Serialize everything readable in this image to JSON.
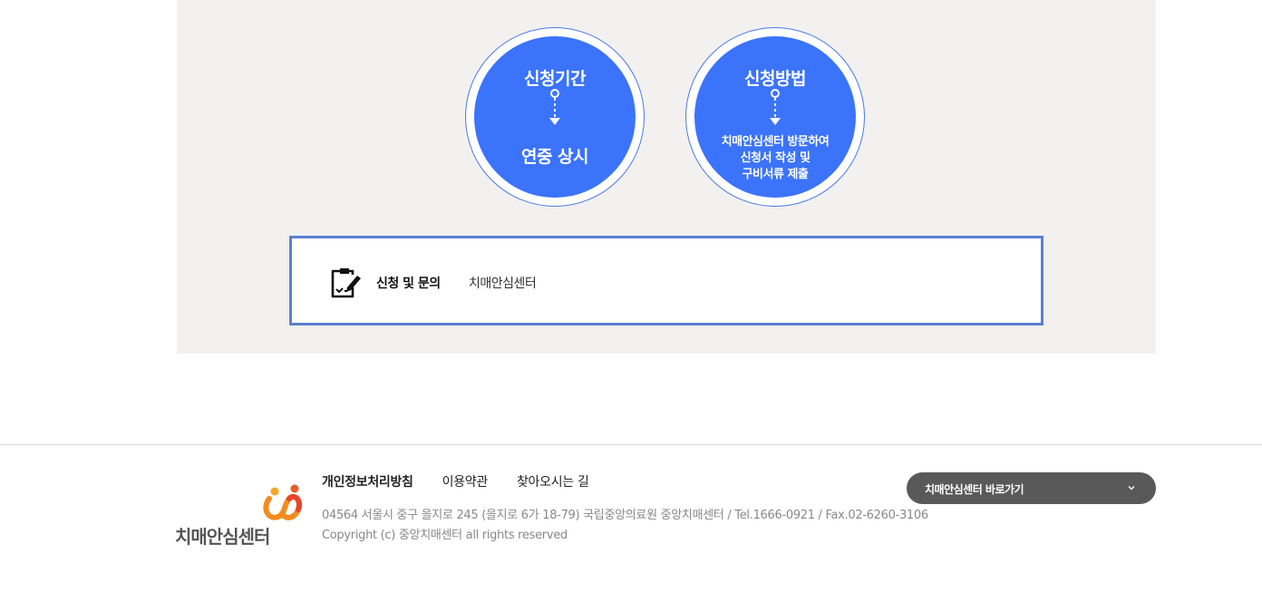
{
  "period": {
    "title": "신청기간",
    "value": "연중 상시"
  },
  "method": {
    "title": "신청방법",
    "lines": [
      "치매안심센터 방문하여",
      "신청서 작성 및",
      "구비서류 제출"
    ]
  },
  "inquiry": {
    "label": "신청 및 문의",
    "value": "치매안심센터",
    "icon": "clipboard-pen-icon"
  },
  "footer": {
    "logo_text": "치매안심센터",
    "links": [
      "개인정보처리방침",
      "이용약관",
      "찾아오시는 길"
    ],
    "address": "04564 서울시 중구 을지로 245 (을지로 6가 18-79) 국립중앙의료원 중앙치매센터 / Tel.1666-0921 / Fax.02-6260-3106",
    "copyright": "Copyright (c) 중앙치매센터 all rights reserved",
    "shortcut_label": "치매안심센터 바로가기"
  },
  "colors": {
    "accent": "#3b73fb",
    "border": "#5a7fcf",
    "panel_bg": "#f2f1f0",
    "shortcut_bg": "#595959"
  }
}
